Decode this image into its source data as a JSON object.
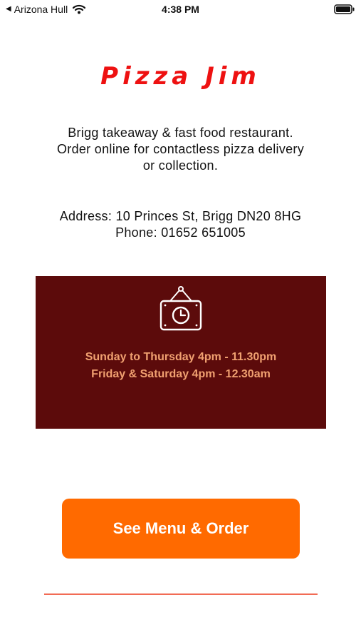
{
  "status_bar": {
    "back_glyph": "◀",
    "carrier": "Arizona Hull",
    "time": "4:38 PM",
    "wifi_icon": "wifi-icon",
    "battery_icon": "battery-icon"
  },
  "header": {
    "title": "Pizza Jim"
  },
  "description": {
    "lines": [
      "Brigg takeaway & fast food restaurant.",
      "Order online for contactless pizza delivery",
      "or collection."
    ]
  },
  "contact": {
    "address": "Address: 10 Princes St, Brigg DN20 8HG",
    "phone": "Phone: 01652 651005"
  },
  "hours": {
    "icon": "clock-sign-icon",
    "lines": [
      "Sunday to Thursday 4pm - 11.30pm",
      "Friday & Saturday 4pm - 12.30am"
    ]
  },
  "cta": {
    "label": "See Menu & Order"
  },
  "colors": {
    "title": "#ee1111",
    "hours_background": "#5c0b0b",
    "hours_text": "#f0a070",
    "button": "#ff6a00",
    "divider": "#f26b55"
  }
}
